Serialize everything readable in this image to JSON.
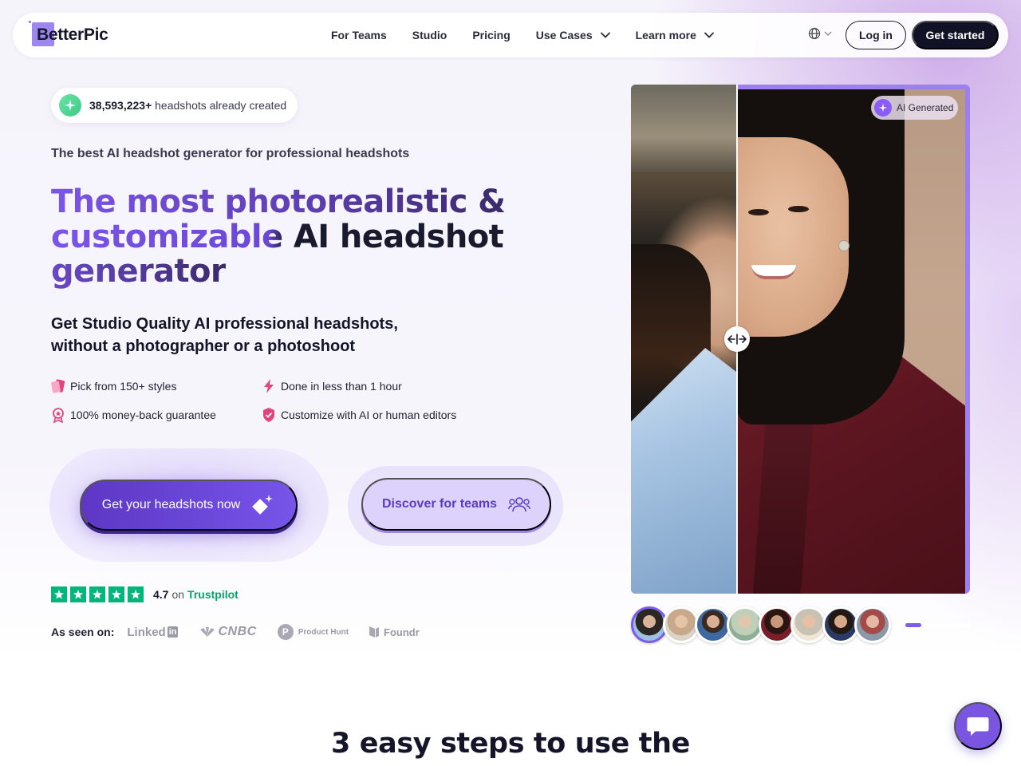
{
  "brand": {
    "name": "BetterPic",
    "accent": "#7c5ce8"
  },
  "nav": {
    "links": [
      {
        "label": "For Teams",
        "dropdown": false
      },
      {
        "label": "Studio",
        "dropdown": false
      },
      {
        "label": "Pricing",
        "dropdown": false
      },
      {
        "label": "Use Cases",
        "dropdown": true
      },
      {
        "label": "Learn more",
        "dropdown": true
      }
    ],
    "language_icon": "globe-icon",
    "login_label": "Log in",
    "cta_label": "Get started"
  },
  "hero": {
    "badge": {
      "count": "38,593,223+",
      "text": " headshots already created",
      "icon": "sparkle-icon"
    },
    "subhead": "The best AI headshot generator for professional headshots",
    "headline": {
      "part1": "The most photorealistic &",
      "part2": "customizable AI headshot",
      "part3": "generator"
    },
    "tagline_line1": "Get Studio Quality AI professional headshots,",
    "tagline_line2": "without a photographer or a photoshoot",
    "features": [
      {
        "label": "Pick from 150+ styles",
        "icon": "styles-icon"
      },
      {
        "label": "Done in less than 1 hour",
        "icon": "lightning-icon"
      },
      {
        "label": "100% money-back guarantee",
        "icon": "award-icon"
      },
      {
        "label": "Customize with AI or human editors",
        "icon": "shield-check-icon"
      }
    ],
    "primary_cta": "Get your headshots now",
    "secondary_cta": "Discover for teams",
    "rating": {
      "score": "4.7",
      "on": "on",
      "platform": "Trustpilot",
      "stars": 5
    },
    "as_seen_on": "As seen on:",
    "press": {
      "linkedin": "Linked",
      "linkedin_box": "in",
      "cnbc": "CNBC",
      "producthunt": "Product Hunt",
      "producthunt_letter": "P",
      "foundr": "Foundr"
    }
  },
  "comparison": {
    "ai_badge": "AI Generated",
    "split_fraction": 0.31,
    "thumb_count": 8,
    "active_thumb": 0,
    "carousel_progress": 0.25
  },
  "steps": {
    "title": "3 easy steps to use the"
  },
  "colors": {
    "primary": "#5d37c4",
    "primary_light": "#ddd2fb",
    "trustpilot": "#00b67a",
    "dark": "#121226"
  }
}
